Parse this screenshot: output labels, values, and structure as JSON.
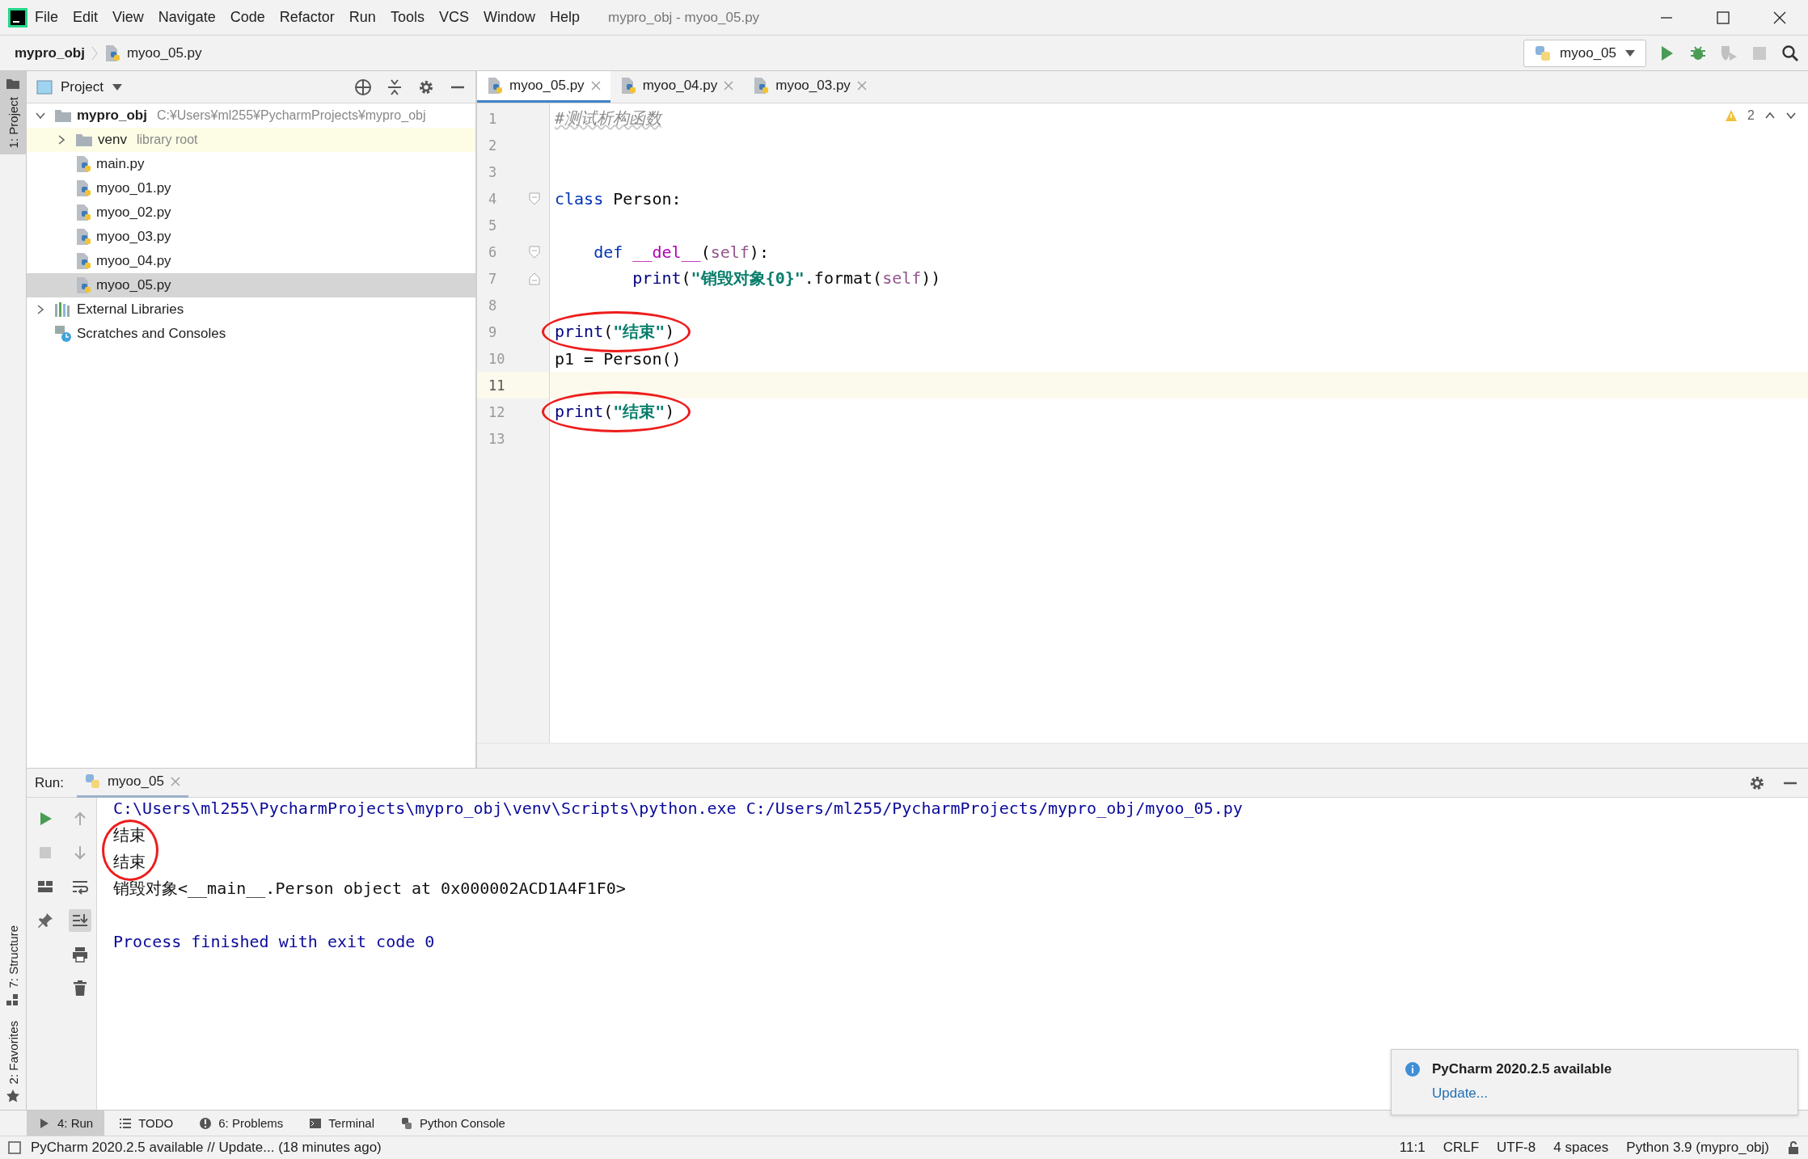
{
  "window": {
    "title": "mypro_obj - myoo_05.py"
  },
  "menu": [
    "File",
    "Edit",
    "View",
    "Navigate",
    "Code",
    "Refactor",
    "Run",
    "Tools",
    "VCS",
    "Window",
    "Help"
  ],
  "breadcrumbs": [
    {
      "label": "mypro_obj",
      "kind": "project"
    },
    {
      "label": "myoo_05.py",
      "kind": "file"
    }
  ],
  "run_config": {
    "label": "myoo_05"
  },
  "toolbar": [
    {
      "kind": "run",
      "disabled": false
    },
    {
      "kind": "debug",
      "disabled": false
    },
    {
      "kind": "coverage",
      "disabled": true
    },
    {
      "kind": "stop",
      "disabled": true
    },
    {
      "kind": "search",
      "disabled": false
    }
  ],
  "left_stripe": [
    {
      "label": "1: Project",
      "kind": "project",
      "selected": true
    },
    {
      "label": "7: Structure",
      "kind": "structure",
      "selected": false
    },
    {
      "label": "2: Favorites",
      "kind": "favorites",
      "selected": false
    }
  ],
  "project_panel": {
    "title": "Project",
    "tree": [
      {
        "label": "mypro_obj",
        "note": "C:¥Users¥ml255¥PycharmProjects¥mypro_obj",
        "kind": "project",
        "expanded": true,
        "selected": false,
        "children": [
          {
            "label": "venv",
            "note": "library root",
            "kind": "library",
            "expanded": false,
            "selected": false
          },
          {
            "label": "main.py",
            "kind": "file",
            "selected": false
          },
          {
            "label": "myoo_01.py",
            "kind": "file",
            "selected": false
          },
          {
            "label": "myoo_02.py",
            "kind": "file",
            "selected": false
          },
          {
            "label": "myoo_03.py",
            "kind": "file",
            "selected": false
          },
          {
            "label": "myoo_04.py",
            "kind": "file",
            "selected": false
          },
          {
            "label": "myoo_05.py",
            "kind": "file",
            "selected": true
          }
        ]
      },
      {
        "label": "External Libraries",
        "kind": "libraries",
        "expanded": false,
        "selected": false
      },
      {
        "label": "Scratches and Consoles",
        "kind": "scratches",
        "selected": false
      }
    ]
  },
  "editor": {
    "tabs": [
      {
        "label": "myoo_05.py",
        "selected": true
      },
      {
        "label": "myoo_04.py",
        "selected": false
      },
      {
        "label": "myoo_03.py",
        "selected": false
      }
    ],
    "inspection": {
      "count": "2"
    },
    "lines": [
      {
        "num": "1",
        "fold_start": false,
        "fold_end": false,
        "current": false,
        "circled": false,
        "tokens": [
          {
            "kind": "comment",
            "text": "#测试析构函数"
          }
        ]
      },
      {
        "num": "2",
        "fold_start": false,
        "fold_end": false,
        "current": false,
        "circled": false
      },
      {
        "num": "3",
        "fold_start": false,
        "fold_end": false,
        "current": false,
        "circled": false
      },
      {
        "num": "4",
        "fold_start": true,
        "fold_end": false,
        "current": false,
        "circled": false,
        "tokens": [
          {
            "kind": "keyword",
            "text": "class"
          },
          {
            "kind": "plain",
            "text": " Person:"
          }
        ]
      },
      {
        "num": "5",
        "fold_start": false,
        "fold_end": false,
        "current": false,
        "circled": false
      },
      {
        "num": "6",
        "fold_start": true,
        "fold_end": false,
        "current": false,
        "circled": false,
        "tokens": [
          {
            "kind": "keyword",
            "text": "    def"
          },
          {
            "kind": "dunder",
            "text": " __del__"
          },
          {
            "kind": "plain",
            "text": "("
          },
          {
            "kind": "self",
            "text": "self"
          },
          {
            "kind": "plain",
            "text": "):"
          }
        ]
      },
      {
        "num": "7",
        "fold_start": false,
        "fold_end": true,
        "current": false,
        "circled": false,
        "tokens": [
          {
            "kind": "builtin",
            "text": "        print"
          },
          {
            "kind": "plain",
            "text": "("
          },
          {
            "kind": "string",
            "text": "\"销毁对象{0}\""
          },
          {
            "kind": "plain",
            "text": ".format("
          },
          {
            "kind": "self",
            "text": "self"
          },
          {
            "kind": "plain",
            "text": "))"
          }
        ]
      },
      {
        "num": "8",
        "fold_start": false,
        "fold_end": false,
        "current": false,
        "circled": false
      },
      {
        "num": "9",
        "fold_start": false,
        "fold_end": false,
        "current": false,
        "circled": true,
        "tokens": [
          {
            "kind": "builtin",
            "text": "print"
          },
          {
            "kind": "plain",
            "text": "("
          },
          {
            "kind": "string",
            "text": "\"结束\""
          },
          {
            "kind": "plain",
            "text": ")"
          }
        ]
      },
      {
        "num": "10",
        "fold_start": false,
        "fold_end": false,
        "current": false,
        "circled": false,
        "tokens": [
          {
            "kind": "plain",
            "text": "p1 = Person()"
          }
        ]
      },
      {
        "num": "11",
        "fold_start": false,
        "fold_end": false,
        "current": true,
        "circled": false
      },
      {
        "num": "12",
        "fold_start": false,
        "fold_end": false,
        "current": false,
        "circled": true,
        "tokens": [
          {
            "kind": "builtin",
            "text": "print"
          },
          {
            "kind": "plain",
            "text": "("
          },
          {
            "kind": "string",
            "text": "\"结束\""
          },
          {
            "kind": "plain",
            "text": ")"
          }
        ]
      },
      {
        "num": "13",
        "fold_start": false,
        "fold_end": false,
        "current": false,
        "circled": false
      }
    ]
  },
  "run_panel": {
    "label": "Run:",
    "tabs": [
      {
        "label": "myoo_05",
        "selected": true
      }
    ],
    "tools_left": [
      {
        "kind": "rerun",
        "disabled": false
      },
      {
        "kind": "stop",
        "disabled": true
      },
      {
        "kind": "layout",
        "disabled": false
      },
      {
        "kind": "pin",
        "disabled": false
      }
    ],
    "tools_right": [
      {
        "kind": "up",
        "on": false
      },
      {
        "kind": "down",
        "on": false
      },
      {
        "kind": "wrap",
        "on": false
      },
      {
        "kind": "scroll-end",
        "on": true
      },
      {
        "kind": "print",
        "on": false
      },
      {
        "kind": "trash",
        "on": false
      }
    ],
    "output": [
      {
        "kind": "command",
        "circled": false,
        "text": "C:\\Users\\ml255\\PycharmProjects\\mypro_obj\\venv\\Scripts\\python.exe C:/Users/ml255/PycharmProjects/mypro_obj/myoo_05.py"
      },
      {
        "kind": "output",
        "circled": true,
        "text": "结束"
      },
      {
        "kind": "output",
        "circled": true,
        "text": "结束"
      },
      {
        "kind": "output",
        "circled": false,
        "text": "销毁对象<__main__.Person object at 0x000002ACD1A4F1F0>"
      },
      {
        "kind": "blank",
        "circled": false
      },
      {
        "kind": "system",
        "circled": false,
        "text": "Process finished with exit code 0"
      }
    ]
  },
  "tool_tabs": [
    {
      "label": "4: Run",
      "kind": "run",
      "selected": true
    },
    {
      "label": "TODO",
      "kind": "todo",
      "selected": false
    },
    {
      "label": "6: Problems",
      "kind": "problems",
      "selected": false
    },
    {
      "label": "Terminal",
      "kind": "terminal",
      "selected": false
    },
    {
      "label": "Python Console",
      "kind": "console",
      "selected": false
    }
  ],
  "notification": {
    "title": "PyCharm 2020.2.5 available",
    "link": "Update..."
  },
  "status_bar": {
    "message": "PyCharm 2020.2.5 available // Update... (18 minutes ago)",
    "items": [
      "11:1",
      "CRLF",
      "UTF-8",
      "4 spaces",
      "Python 3.9 (mypro_obj)"
    ]
  }
}
